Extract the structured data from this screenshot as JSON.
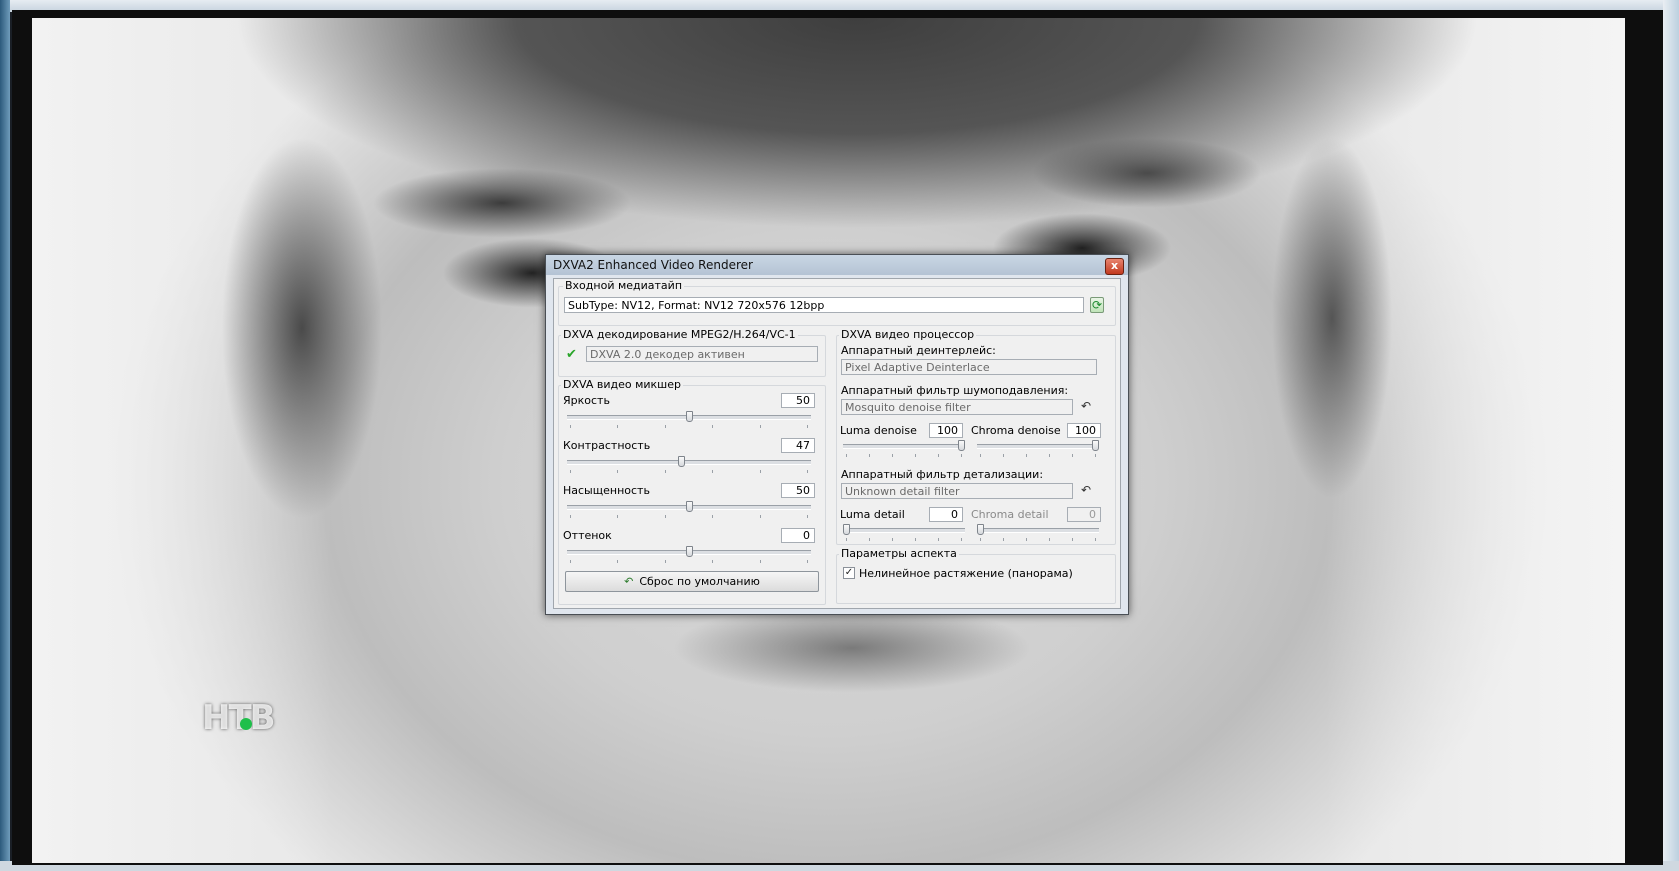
{
  "dialog": {
    "title": "DXVA2 Enhanced Video Renderer",
    "close_glyph": "x",
    "input": {
      "group_label": "Входной медиатайп",
      "value": "SubType: NV12, Format: NV12 720x576 12bpp",
      "refresh_glyph": "⟳"
    },
    "decoding": {
      "group_label": "DXVA декодирование MPEG2/H.264/VC-1",
      "check_glyph": "✔",
      "status": "DXVA 2.0 декодер активен"
    },
    "mixer": {
      "group_label": "DXVA видео микшер",
      "controls": [
        {
          "label": "Яркость",
          "value": "50",
          "level": 0.5
        },
        {
          "label": "Контрастность",
          "value": "47",
          "level": 0.47
        },
        {
          "label": "Насыщенность",
          "value": "50",
          "level": 0.5
        },
        {
          "label": "Оттенок",
          "value": "0",
          "level": 0.5
        }
      ],
      "reset_glyph": "↶",
      "reset_label": "Сброс по умолчанию"
    },
    "processor": {
      "group_label": "DXVA видео процессор",
      "deinterlace_label": "Аппаратный деинтерлейс:",
      "deinterlace_value": "Pixel Adaptive Deinterlace",
      "denoise_label": "Аппаратный фильтр шумоподавления:",
      "denoise_value": "Mosquito denoise filter",
      "luma_denoise_label": "Luma denoise",
      "luma_denoise_value": "100",
      "chroma_denoise_label": "Chroma denoise",
      "chroma_denoise_value": "100",
      "detail_label": "Аппаратный фильтр детализации:",
      "detail_value": "Unknown detail filter",
      "luma_detail_label": "Luma detail",
      "luma_detail_value": "0",
      "chroma_detail_label": "Chroma detail",
      "chroma_detail_value": "0",
      "undo_glyph": "↶"
    },
    "aspect": {
      "group_label": "Параметры аспекта",
      "checkbox_glyph": "✓",
      "nonlinear_label": "Нелинейное растяжение (панорама)",
      "nonlinear_checked": true
    }
  },
  "video": {
    "channel_logo": "НТВ"
  }
}
